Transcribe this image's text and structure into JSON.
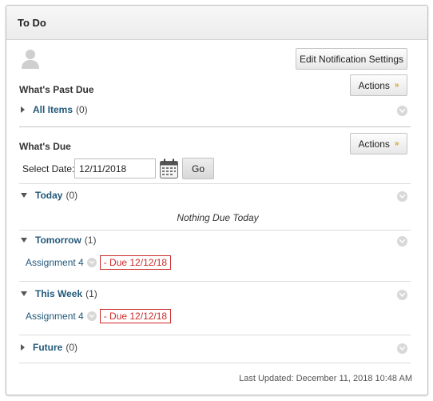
{
  "module": {
    "title": "To Do"
  },
  "header_buttons": {
    "edit_notification_settings": "Edit Notification Settings"
  },
  "past_due": {
    "heading": "What's Past Due",
    "actions_label": "Actions",
    "all_items_label": "All Items",
    "all_items_count": "(0)"
  },
  "due": {
    "heading": "What's Due",
    "actions_label": "Actions",
    "select_date_label": "Select Date:",
    "date_value": "12/11/2018",
    "go_label": "Go",
    "groups": [
      {
        "label": "Today",
        "count": "(0)",
        "empty_text": "Nothing Due Today"
      },
      {
        "label": "Tomorrow",
        "count": "(1)",
        "items": [
          {
            "title": "Assignment 4",
            "due": "- Due 12/12/18"
          }
        ]
      },
      {
        "label": "This Week",
        "count": "(1)",
        "items": [
          {
            "title": "Assignment 4",
            "due": "- Due 12/12/18"
          }
        ]
      },
      {
        "label": "Future",
        "count": "(0)"
      }
    ]
  },
  "footer": {
    "last_updated": "Last Updated: December 11, 2018 10:48 AM"
  },
  "colors": {
    "link": "#23597a",
    "due_red": "#cc2a2a",
    "actions_chevron": "#c9a227"
  },
  "icons": [
    "user-avatar-icon",
    "calendar-icon",
    "chevron-down-icon",
    "triangle-right-icon",
    "triangle-down-icon"
  ]
}
